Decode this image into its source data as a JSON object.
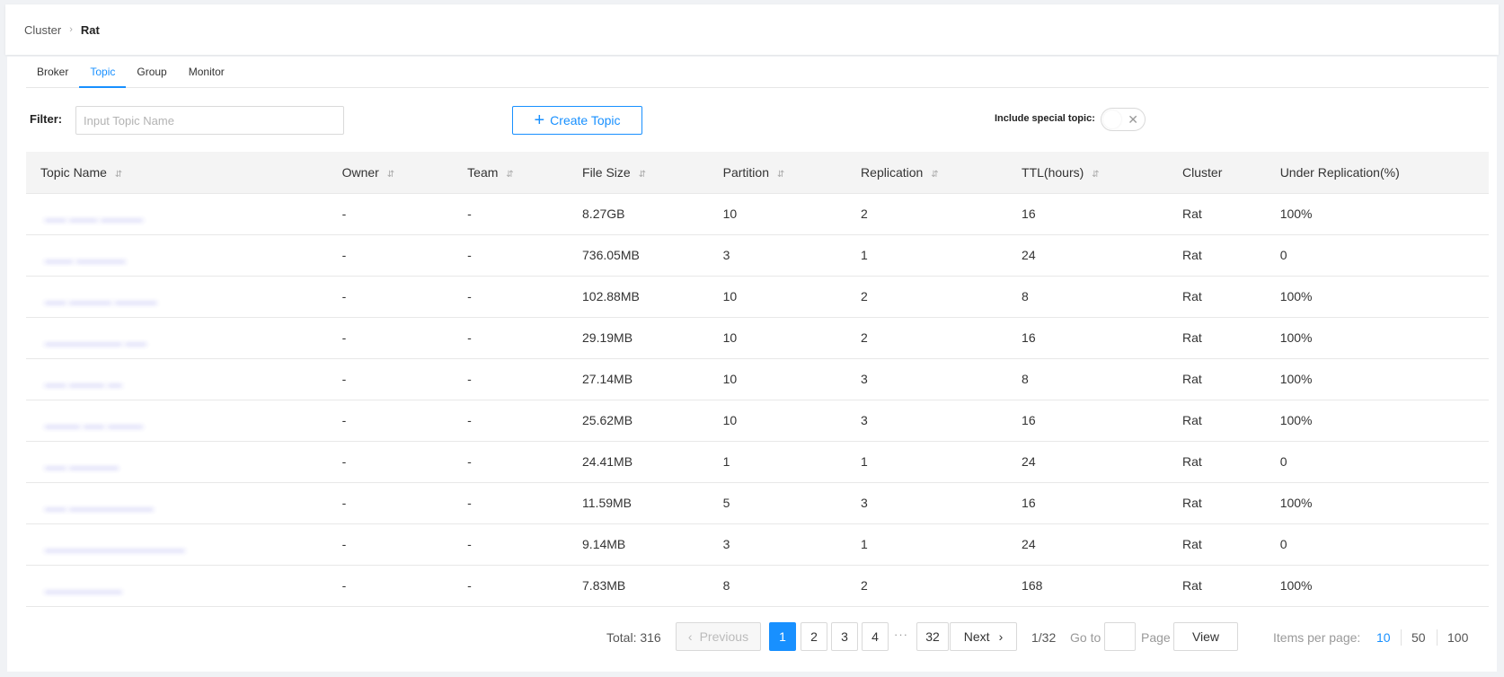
{
  "breadcrumb": {
    "root": "Cluster",
    "separator": "›",
    "current": "Rat"
  },
  "tabs": [
    {
      "label": "Broker",
      "active": false
    },
    {
      "label": "Topic",
      "active": true
    },
    {
      "label": "Group",
      "active": false
    },
    {
      "label": "Monitor",
      "active": false
    }
  ],
  "filter": {
    "label": "Filter:",
    "placeholder": "Input Topic Name",
    "value": ""
  },
  "create_button": {
    "label": "Create Topic",
    "icon": "plus-icon"
  },
  "special_topic": {
    "label": "Include special topic:",
    "enabled": false
  },
  "colors": {
    "accent": "#1890ff",
    "link": "#3b3bd9",
    "header_bg": "#f4f4f4"
  },
  "table": {
    "columns": [
      {
        "label": "Topic Name",
        "sortable": true
      },
      {
        "label": "Owner",
        "sortable": true
      },
      {
        "label": "Team",
        "sortable": true
      },
      {
        "label": "File Size",
        "sortable": true
      },
      {
        "label": "Partition",
        "sortable": true
      },
      {
        "label": "Replication",
        "sortable": true
      },
      {
        "label": "TTL(hours)",
        "sortable": true
      },
      {
        "label": "Cluster",
        "sortable": false
      },
      {
        "label": "Under Replication(%)",
        "sortable": false
      }
    ],
    "rows": [
      {
        "topic": "___ ____ ______",
        "owner": "-",
        "team": "-",
        "file_size": "8.27GB",
        "partition": "10",
        "replication": "2",
        "ttl": "16",
        "cluster": "Rat",
        "under_replication": "100%"
      },
      {
        "topic": "____ _______",
        "owner": "-",
        "team": "-",
        "file_size": "736.05MB",
        "partition": "3",
        "replication": "1",
        "ttl": "24",
        "cluster": "Rat",
        "under_replication": "0"
      },
      {
        "topic": "___ ______ ______",
        "owner": "-",
        "team": "-",
        "file_size": "102.88MB",
        "partition": "10",
        "replication": "2",
        "ttl": "8",
        "cluster": "Rat",
        "under_replication": "100%"
      },
      {
        "topic": "___________ ___",
        "owner": "-",
        "team": "-",
        "file_size": "29.19MB",
        "partition": "10",
        "replication": "2",
        "ttl": "16",
        "cluster": "Rat",
        "under_replication": "100%"
      },
      {
        "topic": "___ _____ __",
        "owner": "-",
        "team": "-",
        "file_size": "27.14MB",
        "partition": "10",
        "replication": "3",
        "ttl": "8",
        "cluster": "Rat",
        "under_replication": "100%"
      },
      {
        "topic": "_____ ___ _____",
        "owner": "-",
        "team": "-",
        "file_size": "25.62MB",
        "partition": "10",
        "replication": "3",
        "ttl": "16",
        "cluster": "Rat",
        "under_replication": "100%"
      },
      {
        "topic": "___ _______",
        "owner": "-",
        "team": "-",
        "file_size": "24.41MB",
        "partition": "1",
        "replication": "1",
        "ttl": "24",
        "cluster": "Rat",
        "under_replication": "0"
      },
      {
        "topic": "___ ____________",
        "owner": "-",
        "team": "-",
        "file_size": "11.59MB",
        "partition": "5",
        "replication": "3",
        "ttl": "16",
        "cluster": "Rat",
        "under_replication": "100%"
      },
      {
        "topic": "____________________",
        "owner": "-",
        "team": "-",
        "file_size": "9.14MB",
        "partition": "3",
        "replication": "1",
        "ttl": "24",
        "cluster": "Rat",
        "under_replication": "0"
      },
      {
        "topic": "___________",
        "owner": "-",
        "team": "-",
        "file_size": "7.83MB",
        "partition": "8",
        "replication": "2",
        "ttl": "168",
        "cluster": "Rat",
        "under_replication": "100%"
      }
    ]
  },
  "pagination": {
    "total": "Total: 316",
    "previous": "Previous",
    "pages": [
      "1",
      "2",
      "3",
      "4"
    ],
    "current_page": "1",
    "ellipsis": "···",
    "last_page": "32",
    "next": "Next",
    "page_info": "1/32",
    "goto_label": "Go to",
    "goto_value": "",
    "page_label": "Page",
    "view_label": "View",
    "items_per_page_label": "Items per page:",
    "items_per_page_options": [
      "10",
      "50",
      "100"
    ],
    "items_per_page_selected": "10"
  }
}
